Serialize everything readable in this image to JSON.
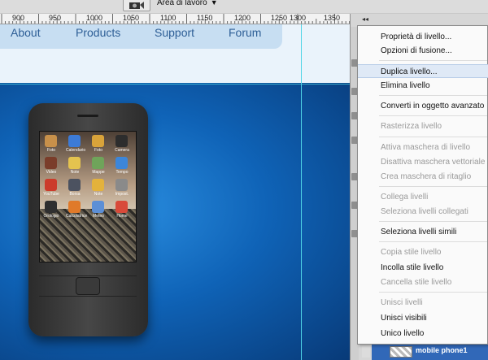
{
  "app": {
    "workspace_label": "Area di lavoro",
    "ruler_labels": [
      "900",
      "950",
      "1000",
      "1050",
      "1100",
      "1150",
      "1200",
      "1250",
      "1300",
      "1350"
    ]
  },
  "website": {
    "nav": [
      "About",
      "Products",
      "Support",
      "Forum"
    ]
  },
  "phone": {
    "apps": [
      {
        "label": "Foto",
        "color": "#c8904a"
      },
      {
        "label": "Calendario",
        "color": "#3d7bd6"
      },
      {
        "label": "Foto",
        "color": "#d9a33a"
      },
      {
        "label": "Camera",
        "color": "#2d2d2d"
      },
      {
        "label": "Video",
        "color": "#7a3d2a"
      },
      {
        "label": "Note",
        "color": "#e4c34f"
      },
      {
        "label": "Mappe",
        "color": "#6fa45a"
      },
      {
        "label": "Tempo",
        "color": "#3c86d9"
      },
      {
        "label": "YouTube",
        "color": "#cc3b2b"
      },
      {
        "label": "Borsa",
        "color": "#4c5260"
      },
      {
        "label": "Note",
        "color": "#e3b23c"
      },
      {
        "label": "Impost.",
        "color": "#8a8a8a"
      },
      {
        "label": "Orologio",
        "color": "#2f2f2f"
      },
      {
        "label": "Calcolatrice",
        "color": "#e07a2a"
      },
      {
        "label": "Meteo",
        "color": "#5c8fd6"
      },
      {
        "label": "Home",
        "color": "#d84a3a"
      }
    ]
  },
  "context_menu": {
    "items": [
      {
        "label": "Proprietà di livello...",
        "disabled": false
      },
      {
        "label": "Opzioni di fusione...",
        "disabled": false
      },
      {
        "label": "Duplica livello...",
        "disabled": false,
        "hover": true
      },
      {
        "label": "Elimina livello",
        "disabled": false
      },
      {
        "label": "Converti in oggetto avanzato",
        "disabled": false
      },
      {
        "label": "Rasterizza livello",
        "disabled": true
      },
      {
        "label": "Attiva maschera di livello",
        "disabled": true
      },
      {
        "label": "Disattiva maschera vettoriale",
        "disabled": true
      },
      {
        "label": "Crea maschera di ritaglio",
        "disabled": true
      },
      {
        "label": "Collega livelli",
        "disabled": true
      },
      {
        "label": "Seleziona livelli collegati",
        "disabled": true
      },
      {
        "label": "Seleziona livelli simili",
        "disabled": false
      },
      {
        "label": "Copia stile livello",
        "disabled": true
      },
      {
        "label": "Incolla stile livello",
        "disabled": false
      },
      {
        "label": "Cancella stile livello",
        "disabled": true
      },
      {
        "label": "Unisci livelli",
        "disabled": true
      },
      {
        "label": "Unisci visibili",
        "disabled": false
      },
      {
        "label": "Unico livello",
        "disabled": false
      }
    ]
  },
  "layers_panel": {
    "selected_layer": "mobile phone1"
  },
  "colors": {
    "menu_hover": "#dfe9f6",
    "guide": "#4fd4e6",
    "nav_text": "#2d5e96",
    "layer_selected": "#3168b8"
  }
}
